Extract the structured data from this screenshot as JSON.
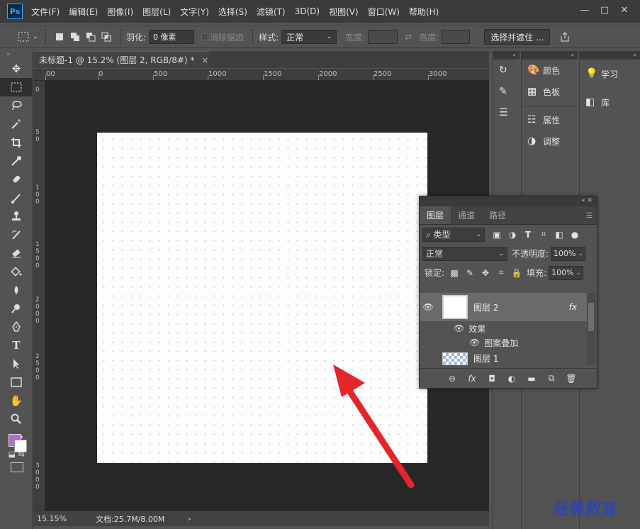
{
  "menubar": {
    "app_logo": "Ps",
    "items": [
      "文件(F)",
      "编辑(E)",
      "图像(I)",
      "图层(L)",
      "文字(Y)",
      "选择(S)",
      "滤镜(T)",
      "3D(D)",
      "视图(V)",
      "窗口(W)",
      "帮助(H)"
    ],
    "controls": {
      "minimize": "—",
      "maximize": "□",
      "close": "✕"
    }
  },
  "options": {
    "feather_label": "羽化:",
    "feather_value": "0 像素",
    "antialias_label": "消除锯齿",
    "style_label": "样式:",
    "style_value": "正常",
    "width_label": "宽度:",
    "height_label": "高度:",
    "select_mask_button": "选择并遮住 ..."
  },
  "document": {
    "tab_title": "未标题-1 @ 15.2% (图层 2, RGB/8#) *",
    "tab_close": "×",
    "ruler_top": [
      "00",
      "0",
      "500",
      "1000",
      "1500",
      "2000",
      "2500",
      "3000"
    ],
    "ruler_left": [
      "0",
      "5",
      "0",
      "1",
      "0",
      "0",
      "1",
      "5",
      "0",
      "0",
      "2",
      "0",
      "0",
      "0",
      "2",
      "5",
      "0",
      "0",
      "3",
      "0",
      "0",
      "0"
    ]
  },
  "status": {
    "zoom": "15.15%",
    "doc_info": "文档:25.7M/8.00M",
    "arrow": "›"
  },
  "panels": {
    "col_b": [
      {
        "icon": "palette-icon",
        "label": "颜色"
      },
      {
        "icon": "grid-icon",
        "label": "色板"
      },
      {
        "icon": "properties-icon",
        "label": "属性"
      },
      {
        "icon": "adjust-icon",
        "label": "调整"
      }
    ],
    "col_c": [
      {
        "icon": "lightbulb-icon",
        "label": "学习"
      },
      {
        "icon": "library-icon",
        "label": "库"
      }
    ]
  },
  "layers_panel": {
    "tabs": [
      "图层",
      "通道",
      "路径"
    ],
    "filter_label": "类型",
    "blend_mode": "正常",
    "opacity_label": "不透明度:",
    "opacity_value": "100%",
    "lock_label": "锁定:",
    "fill_label": "填充:",
    "fill_value": "100%",
    "layers": [
      {
        "name": "图层 2",
        "fx": "fx",
        "selected": true
      },
      {
        "name": "图层 1",
        "fx": "",
        "selected": false
      }
    ],
    "effects_label": "效果",
    "effect_item": "图案叠加",
    "bottom_icons": [
      "link-icon",
      "fx-icon",
      "mask-icon",
      "adjustment-icon",
      "folder-icon",
      "new-layer-icon",
      "trash-icon"
    ],
    "bottom_glyphs": [
      "⊖",
      "fx",
      "◘",
      "◐",
      "▬",
      "⧉",
      "🗑"
    ]
  },
  "colors": {
    "foreground": "#b46bd6",
    "background": "#ffffff",
    "arrow": "#e5252a",
    "watermark": "#2c45b8"
  },
  "watermark": "最需教育"
}
